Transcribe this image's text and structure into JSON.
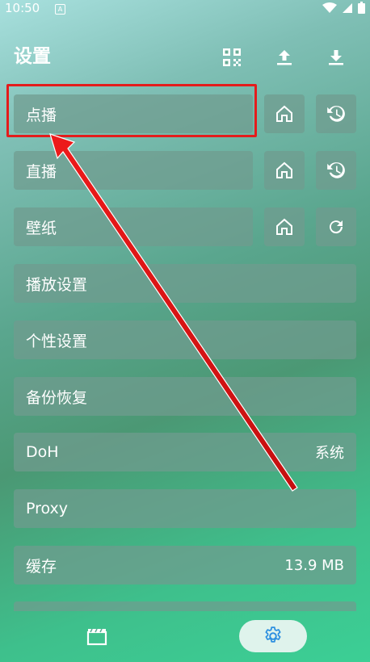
{
  "status": {
    "time": "10:50"
  },
  "header": {
    "title": "设置"
  },
  "toolbar_icons": [
    "qr-code-icon",
    "upload-icon",
    "download-icon"
  ],
  "rows": {
    "vod": {
      "label": "点播"
    },
    "live": {
      "label": "直播"
    },
    "wallpaper": {
      "label": "壁纸"
    },
    "player": {
      "label": "播放设置"
    },
    "personal": {
      "label": "个性设置"
    },
    "backup": {
      "label": "备份恢复"
    },
    "doh": {
      "label": "DoH",
      "value": "系统"
    },
    "proxy": {
      "label": "Proxy"
    },
    "cache": {
      "label": "缓存",
      "value": "13.9 MB"
    }
  },
  "colors": {
    "highlight": "#e41c1c",
    "row_bg": "#709b8f",
    "tab_active_bg": "#dff3ec",
    "tab_active_icon": "#2c8fe0"
  }
}
